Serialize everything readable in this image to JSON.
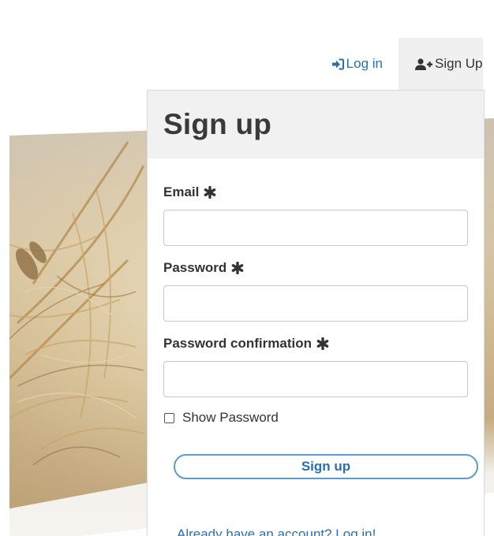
{
  "nav": {
    "login_label": "Log in",
    "signup_label": "Sign Up",
    "login_icon": "sign-in-icon",
    "signup_icon": "user-plus-icon"
  },
  "form": {
    "title": "Sign up",
    "email_label": "Email",
    "password_label": "Password",
    "password_confirmation_label": "Password confirmation",
    "email_value": "",
    "password_value": "",
    "password_confirmation_value": "",
    "show_password_label": "Show Password",
    "show_password_checked": false,
    "submit_label": "Sign up",
    "login_link_label": "Already have an account? Log in!",
    "required_icon": "asterisk-icon"
  },
  "colors": {
    "accent": "#2a6fb0",
    "button_border": "#5a9bd0",
    "header_bg": "#f1f1f1"
  }
}
